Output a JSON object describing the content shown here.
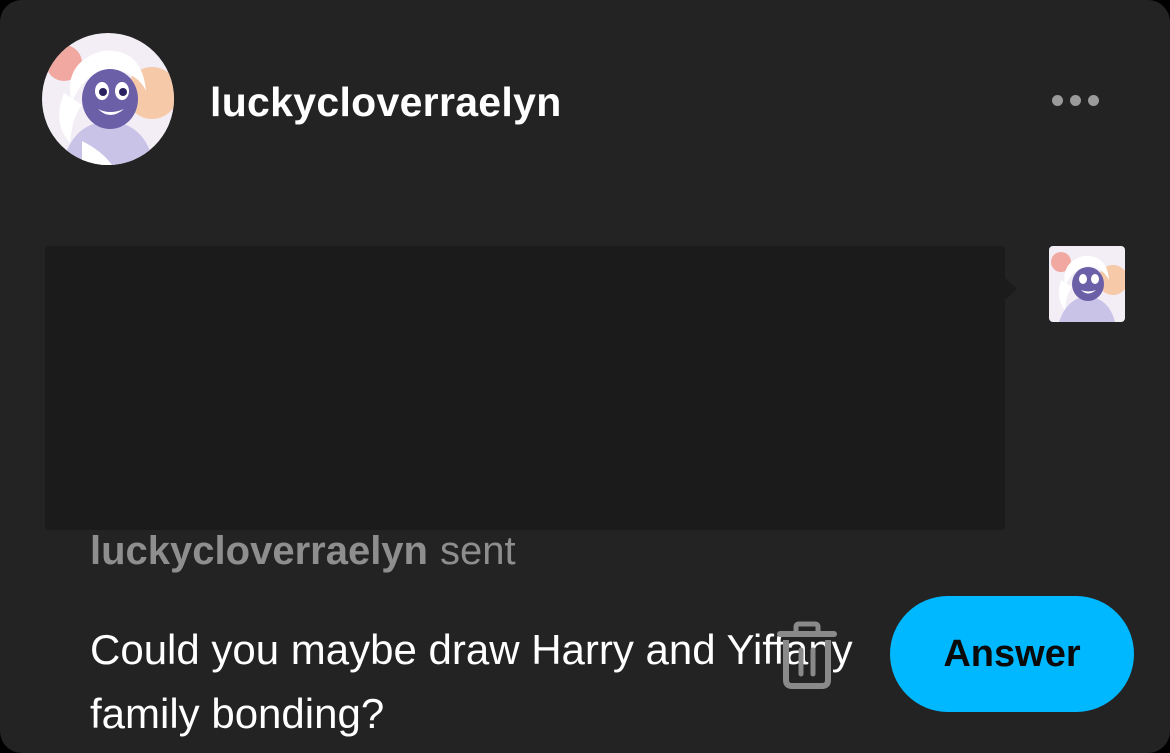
{
  "header": {
    "blog_name": "luckycloverraelyn",
    "avatar_icon": "character-avatar-icon",
    "more_icon": "more-dots-icon"
  },
  "ask": {
    "sender_name": "luckycloverraelyn",
    "sender_verb": "sent",
    "message": "Could you maybe draw Harry and Yiffany family bonding?",
    "sender_thumb_icon": "character-avatar-thumbnail"
  },
  "actions": {
    "delete_icon": "trash-icon",
    "answer_label": "Answer"
  },
  "colors": {
    "card_background": "#232323",
    "bubble_background": "#1b1b1b",
    "answer_button": "#00b8ff",
    "muted_text": "#8e8e8e"
  }
}
